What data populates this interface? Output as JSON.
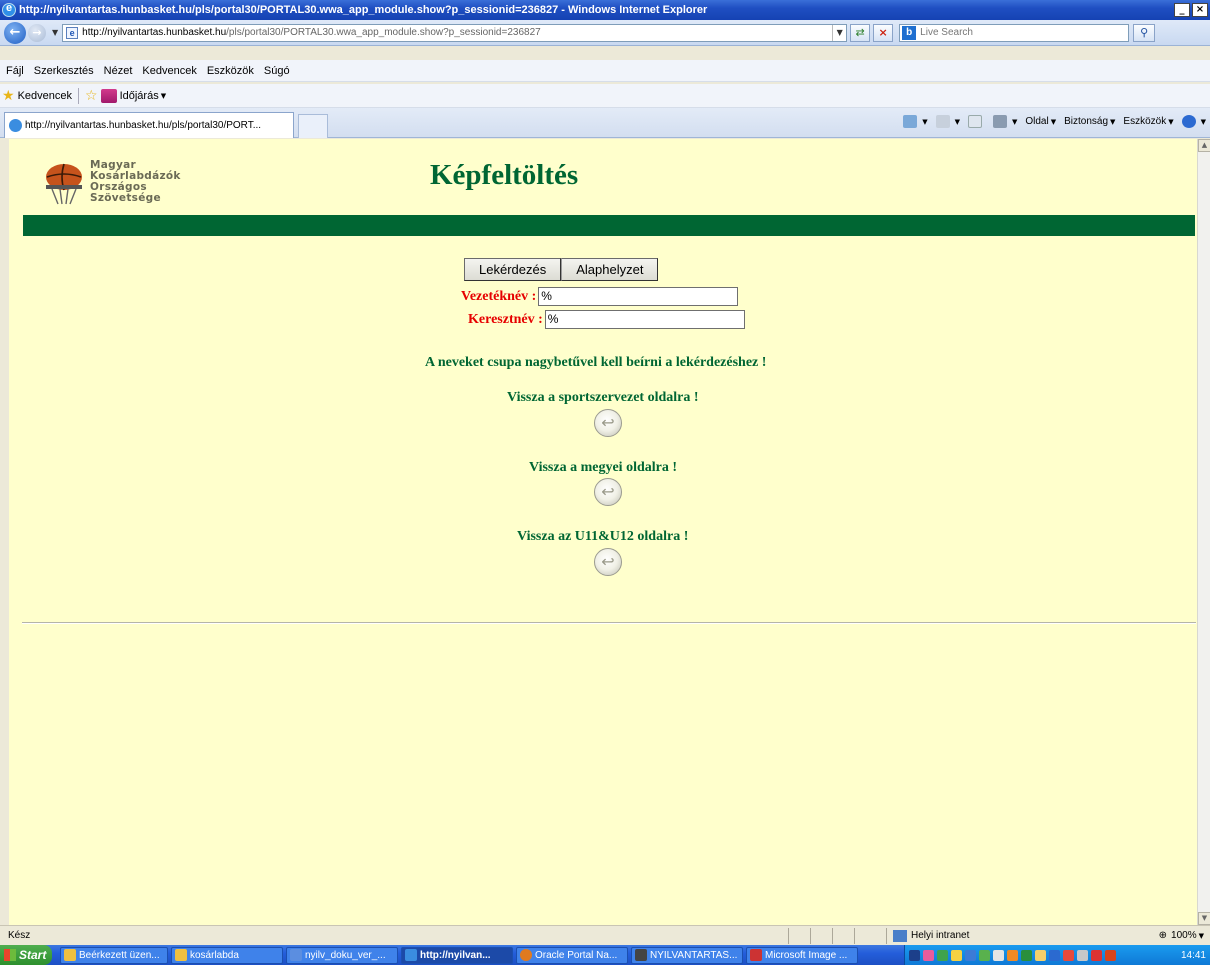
{
  "window": {
    "title": "http://nyilvantartas.hunbasket.hu/pls/portal30/PORTAL30.wwa_app_module.show?p_sessionid=236827 - Windows Internet Explorer",
    "controls": [
      "_",
      "×"
    ]
  },
  "address": {
    "url_main": "http://nyilvantartas.hunbasket.hu",
    "url_rest": "/pls/portal30/PORTAL30.wwa_app_module.show?p_sessionid=236827",
    "search_placeholder": "Live Search"
  },
  "menu": [
    "Fájl",
    "Szerkesztés",
    "Nézet",
    "Kedvencek",
    "Eszközök",
    "Súgó"
  ],
  "favorites": {
    "label": "Kedvencek",
    "weather": "Időjárás"
  },
  "tab": {
    "title": "http://nyilvantartas.hunbasket.hu/pls/portal30/PORT..."
  },
  "commandbar": {
    "oldal": "Oldal",
    "biztonsag": "Biztonság",
    "eszkozok": "Eszközök"
  },
  "page": {
    "logo_lines": [
      "Magyar",
      "Kosárlabdázók",
      "Országos",
      "Szövetsége"
    ],
    "title": "Képfeltöltés",
    "buttons": {
      "query": "Lekérdezés",
      "reset": "Alaphelyzet"
    },
    "fields": {
      "last_name_label": "Vezetéknév :",
      "last_name_value": "%",
      "first_name_label": "Keresztnév :",
      "first_name_value": "%"
    },
    "notice": "A neveket csupa nagybetűvel kell beírni a lekérdezéshez !",
    "links": {
      "sport": "Vissza a sportszervezet oldalra !",
      "county": "Vissza a megyei oldalra !",
      "u11": "Vissza az U11&U12 oldalra !"
    }
  },
  "statusbar": {
    "status": "Kész",
    "zone": "Helyi intranet",
    "zoom": "100%"
  },
  "taskbar": {
    "start": "Start",
    "tasks": [
      "Beérkezett üzen...",
      "kosárlabda",
      "nyilv_doku_ver_...",
      "http://nyilvan...",
      "Oracle Portal Na...",
      "NYILVANTARTAS...",
      "Microsoft Image ..."
    ],
    "clock": "14:41"
  }
}
